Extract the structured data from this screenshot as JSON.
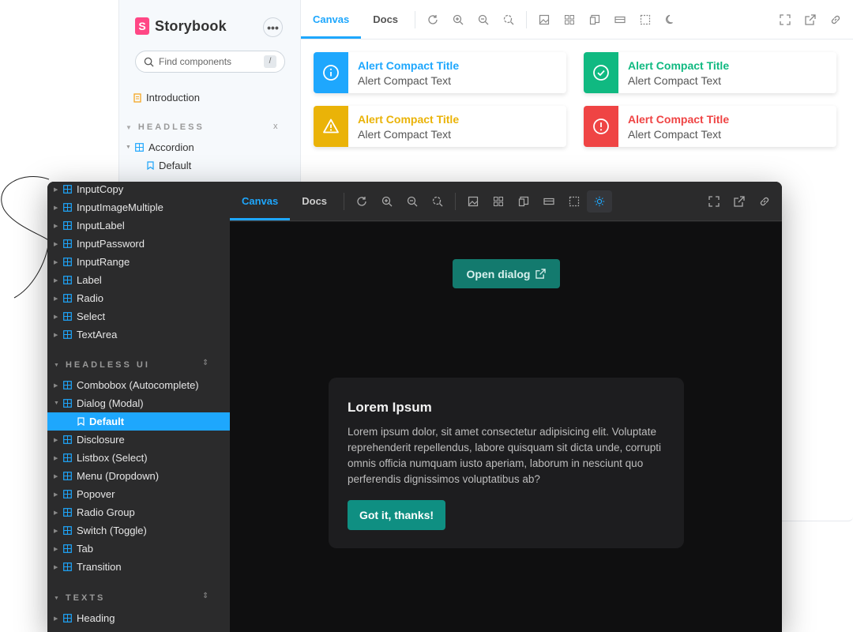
{
  "light": {
    "logo_letter": "S",
    "logo_text": "Storybook",
    "more_label": "•••",
    "search_placeholder": "Find components",
    "search_shortcut": "/",
    "introduction": "Introduction",
    "section": "HEADLESS",
    "section_action": "x",
    "accordion": "Accordion",
    "default": "Default",
    "tabs": [
      "Canvas",
      "Docs"
    ],
    "alerts": [
      {
        "title": "Alert Compact Title",
        "text": "Alert Compact Text",
        "color": "#1ea7fd",
        "icon": "info-icon"
      },
      {
        "title": "Alert Compact Title",
        "text": "Alert Compact Text",
        "color": "#10b981",
        "icon": "check-icon"
      },
      {
        "title": "Alert Compact Title",
        "text": "Alert Compact Text",
        "color": "#eab308",
        "icon": "warning-icon"
      },
      {
        "title": "Alert Compact Title",
        "text": "Alert Compact Text",
        "color": "#ef4444",
        "icon": "error-icon"
      }
    ]
  },
  "dark": {
    "items_top": [
      "InputCopy",
      "InputImageMultiple",
      "InputLabel",
      "InputPassword",
      "InputRange",
      "Label",
      "Radio",
      "Select",
      "TextArea"
    ],
    "section_headless_ui": "HEADLESS UI",
    "items_headless_ui": [
      "Combobox (Autocomplete)",
      "Dialog (Modal)",
      "Default",
      "Disclosure",
      "Listbox (Select)",
      "Menu (Dropdown)",
      "Popover",
      "Radio Group",
      "Switch (Toggle)",
      "Tab",
      "Transition"
    ],
    "section_texts": "TEXTS",
    "items_texts": [
      "Heading"
    ],
    "tabs": [
      "Canvas",
      "Docs"
    ],
    "open_dialog": "Open dialog",
    "dialog": {
      "title": "Lorem Ipsum",
      "text": "Lorem ipsum dolor, sit amet consectetur adipisicing elit. Voluptate reprehenderit repellendus, labore quisquam sit dicta unde, corrupti omnis officia numquam iusto aperiam, laborum in nesciunt quo perferendis dignissimos voluptatibus ab?",
      "button": "Got it, thanks!"
    }
  },
  "colors": {
    "accent": "#1ea7fd",
    "brand": "#ff4785",
    "teal_button": "#0f8f82"
  }
}
